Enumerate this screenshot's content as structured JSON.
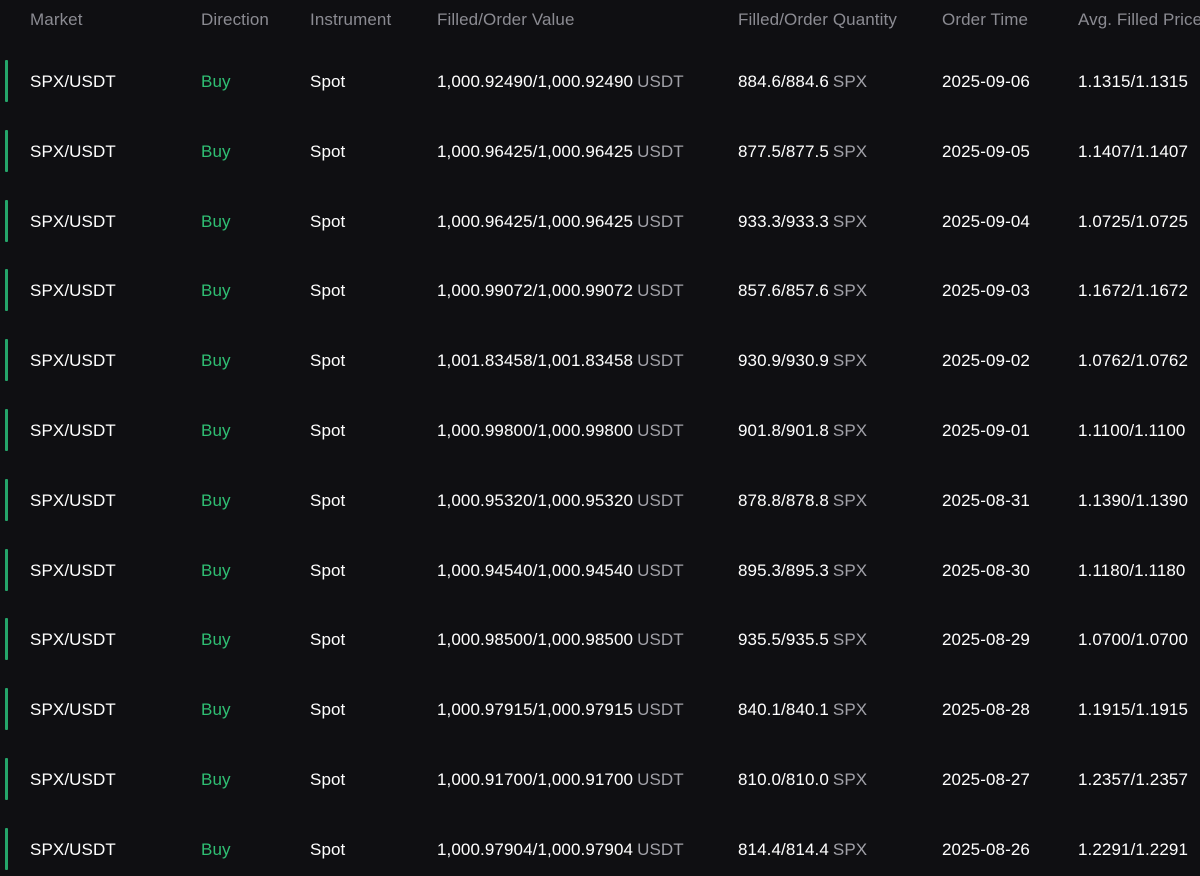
{
  "table": {
    "columns": [
      "Market",
      "Direction",
      "Instrument",
      "Filled/Order Value",
      "Filled/Order Quantity",
      "Order Time",
      "Avg. Filled Price"
    ],
    "rows": [
      {
        "market": "SPX/USDT",
        "direction": "Buy",
        "instrument": "Spot",
        "value": "1,000.92490/1,000.92490",
        "value_unit": "USDT",
        "quantity": "884.6/884.6",
        "quantity_unit": "SPX",
        "order_time": "2025-09-06",
        "avg_price": "1.1315/1.1315"
      },
      {
        "market": "SPX/USDT",
        "direction": "Buy",
        "instrument": "Spot",
        "value": "1,000.96425/1,000.96425",
        "value_unit": "USDT",
        "quantity": "877.5/877.5",
        "quantity_unit": "SPX",
        "order_time": "2025-09-05",
        "avg_price": "1.1407/1.1407"
      },
      {
        "market": "SPX/USDT",
        "direction": "Buy",
        "instrument": "Spot",
        "value": "1,000.96425/1,000.96425",
        "value_unit": "USDT",
        "quantity": "933.3/933.3",
        "quantity_unit": "SPX",
        "order_time": "2025-09-04",
        "avg_price": "1.0725/1.0725"
      },
      {
        "market": "SPX/USDT",
        "direction": "Buy",
        "instrument": "Spot",
        "value": "1,000.99072/1,000.99072",
        "value_unit": "USDT",
        "quantity": "857.6/857.6",
        "quantity_unit": "SPX",
        "order_time": "2025-09-03",
        "avg_price": "1.1672/1.1672"
      },
      {
        "market": "SPX/USDT",
        "direction": "Buy",
        "instrument": "Spot",
        "value": "1,001.83458/1,001.83458",
        "value_unit": "USDT",
        "quantity": "930.9/930.9",
        "quantity_unit": "SPX",
        "order_time": "2025-09-02",
        "avg_price": "1.0762/1.0762"
      },
      {
        "market": "SPX/USDT",
        "direction": "Buy",
        "instrument": "Spot",
        "value": "1,000.99800/1,000.99800",
        "value_unit": "USDT",
        "quantity": "901.8/901.8",
        "quantity_unit": "SPX",
        "order_time": "2025-09-01",
        "avg_price": "1.1100/1.1100"
      },
      {
        "market": "SPX/USDT",
        "direction": "Buy",
        "instrument": "Spot",
        "value": "1,000.95320/1,000.95320",
        "value_unit": "USDT",
        "quantity": "878.8/878.8",
        "quantity_unit": "SPX",
        "order_time": "2025-08-31",
        "avg_price": "1.1390/1.1390"
      },
      {
        "market": "SPX/USDT",
        "direction": "Buy",
        "instrument": "Spot",
        "value": "1,000.94540/1,000.94540",
        "value_unit": "USDT",
        "quantity": "895.3/895.3",
        "quantity_unit": "SPX",
        "order_time": "2025-08-30",
        "avg_price": "1.1180/1.1180"
      },
      {
        "market": "SPX/USDT",
        "direction": "Buy",
        "instrument": "Spot",
        "value": "1,000.98500/1,000.98500",
        "value_unit": "USDT",
        "quantity": "935.5/935.5",
        "quantity_unit": "SPX",
        "order_time": "2025-08-29",
        "avg_price": "1.0700/1.0700"
      },
      {
        "market": "SPX/USDT",
        "direction": "Buy",
        "instrument": "Spot",
        "value": "1,000.97915/1,000.97915",
        "value_unit": "USDT",
        "quantity": "840.1/840.1",
        "quantity_unit": "SPX",
        "order_time": "2025-08-28",
        "avg_price": "1.1915/1.1915"
      },
      {
        "market": "SPX/USDT",
        "direction": "Buy",
        "instrument": "Spot",
        "value": "1,000.91700/1,000.91700",
        "value_unit": "USDT",
        "quantity": "810.0/810.0",
        "quantity_unit": "SPX",
        "order_time": "2025-08-27",
        "avg_price": "1.2357/1.2357"
      },
      {
        "market": "SPX/USDT",
        "direction": "Buy",
        "instrument": "Spot",
        "value": "1,000.97904/1,000.97904",
        "value_unit": "USDT",
        "quantity": "814.4/814.4",
        "quantity_unit": "SPX",
        "order_time": "2025-08-26",
        "avg_price": "1.2291/1.2291"
      }
    ]
  },
  "colors": {
    "background": "#0f0f12",
    "header_text": "#8b8b92",
    "buy": "#2fbf73",
    "accent_bar": "#25a56a",
    "unit_text": "#a1a1a8"
  }
}
